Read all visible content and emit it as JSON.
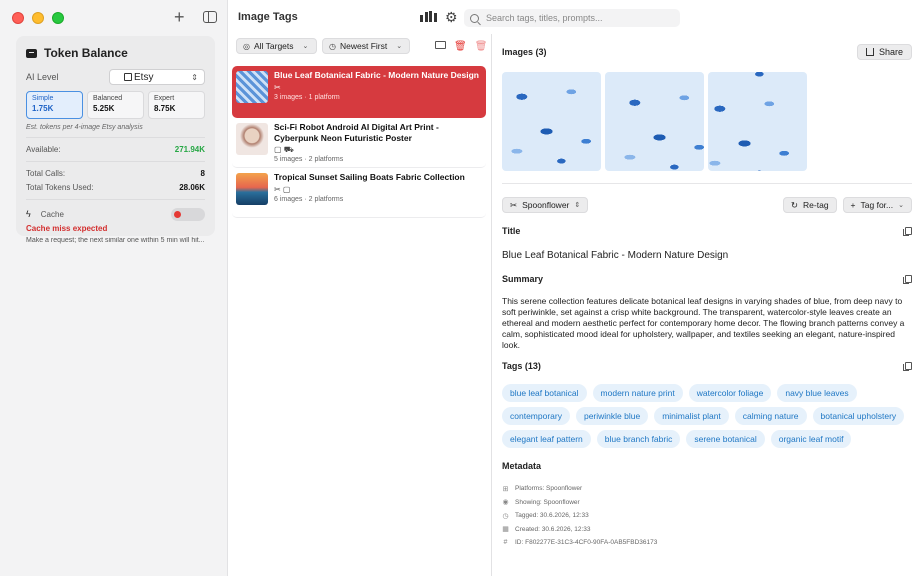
{
  "app": {
    "title": "Image Tags"
  },
  "search": {
    "placeholder": "Search tags, titles, prompts..."
  },
  "token_balance": {
    "title": "Token Balance",
    "ai_level_label": "AI Level",
    "platform": "Etsy",
    "levels": [
      {
        "name": "Simple",
        "value": "1.75K",
        "active": true
      },
      {
        "name": "Balanced",
        "value": "5.25K",
        "active": false
      },
      {
        "name": "Expert",
        "value": "8.75K",
        "active": false
      }
    ],
    "note": "Est. tokens per 4-image Etsy analysis",
    "available_label": "Available:",
    "available_value": "271.94K",
    "total_calls_label": "Total Calls:",
    "total_calls_value": "8",
    "total_tokens_label": "Total Tokens Used:",
    "total_tokens_value": "28.06K",
    "cache_label": "Cache",
    "cache_status": "Cache miss expected",
    "cache_note": "Make a request; the next similar one within 5 min will hit..."
  },
  "filters": {
    "target": "All Targets",
    "sort": "Newest First"
  },
  "list": [
    {
      "title": "Blue Leaf Botanical Fabric - Modern Nature Design",
      "icons": "✂",
      "meta": "3 images · 1 platform"
    },
    {
      "title": "Sci-Fi Robot Android AI Digital Art Print - Cyberpunk Neon Futuristic Poster",
      "icons": "▢ ⛟",
      "meta": "5 images · 2 platforms"
    },
    {
      "title": "Tropical Sunset Sailing Boats Fabric Collection",
      "icons": "✂ ▢",
      "meta": "6 images · 2 platforms"
    }
  ],
  "detail": {
    "images_label": "Images (3)",
    "share_label": "Share",
    "platform_button": "Spoonflower",
    "retag_label": "Re-tag",
    "tagfor_label": "Tag for...",
    "title_label": "Title",
    "title_value": "Blue Leaf Botanical Fabric - Modern Nature Design",
    "summary_label": "Summary",
    "summary_text": "This serene collection features delicate botanical leaf designs in varying shades of blue, from deep navy to soft periwinkle, set against a crisp white background. The transparent, watercolor-style leaves create an ethereal and modern aesthetic perfect for contemporary home decor. The flowing branch patterns convey a calm, sophisticated mood ideal for upholstery, wallpaper, and textiles seeking an elegant, nature-inspired look.",
    "tags_label": "Tags (13)",
    "tags": [
      "blue leaf botanical",
      "modern nature print",
      "watercolor foliage",
      "navy blue leaves",
      "contemporary",
      "periwinkle blue",
      "minimalist plant",
      "calming nature",
      "botanical upholstery",
      "elegant leaf pattern",
      "blue branch fabric",
      "serene botanical",
      "organic leaf motif"
    ],
    "metadata_label": "Metadata",
    "metadata": [
      {
        "icon": "grid-icon",
        "text": "Platforms: Spoonflower"
      },
      {
        "icon": "eye-icon",
        "text": "Showing: Spoonflower"
      },
      {
        "icon": "clock-icon",
        "text": "Tagged: 30.6.2026, 12:33"
      },
      {
        "icon": "calendar-icon",
        "text": "Created: 30.6.2026, 12:33"
      },
      {
        "icon": "hash-icon",
        "text": "ID: F802277E-31C3-4CF0-90FA-0AB5FBD36173"
      }
    ]
  },
  "colors": {
    "accent_red": "#d63a3f",
    "tag_blue": "#1f77c4",
    "available_green": "#27a745"
  }
}
